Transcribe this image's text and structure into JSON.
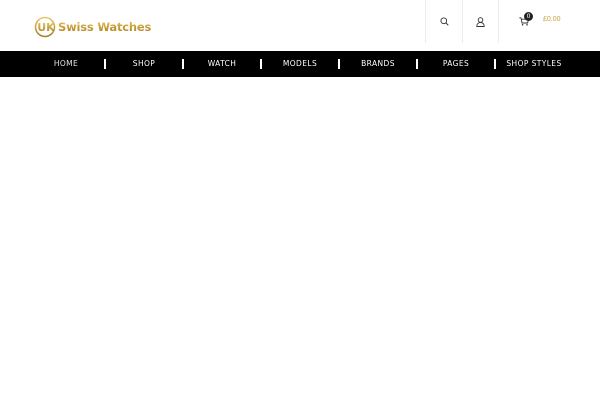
{
  "header": {
    "logo": {
      "emblem_text": "UK",
      "brand_text": "Swiss Watches"
    },
    "icons": {
      "search": "search-icon",
      "account": "user-icon",
      "cart": "cart-icon"
    },
    "cart": {
      "count": "0",
      "total": "£0.00"
    },
    "colors": {
      "accent": "#c9a240",
      "nav_background": "#000000"
    }
  },
  "nav": {
    "items": [
      {
        "label": "HOME"
      },
      {
        "label": "SHOP"
      },
      {
        "label": "WATCH"
      },
      {
        "label": "MODELS"
      },
      {
        "label": "BRANDS"
      },
      {
        "label": "PAGES"
      },
      {
        "label": "SHOP STYLES"
      }
    ]
  }
}
